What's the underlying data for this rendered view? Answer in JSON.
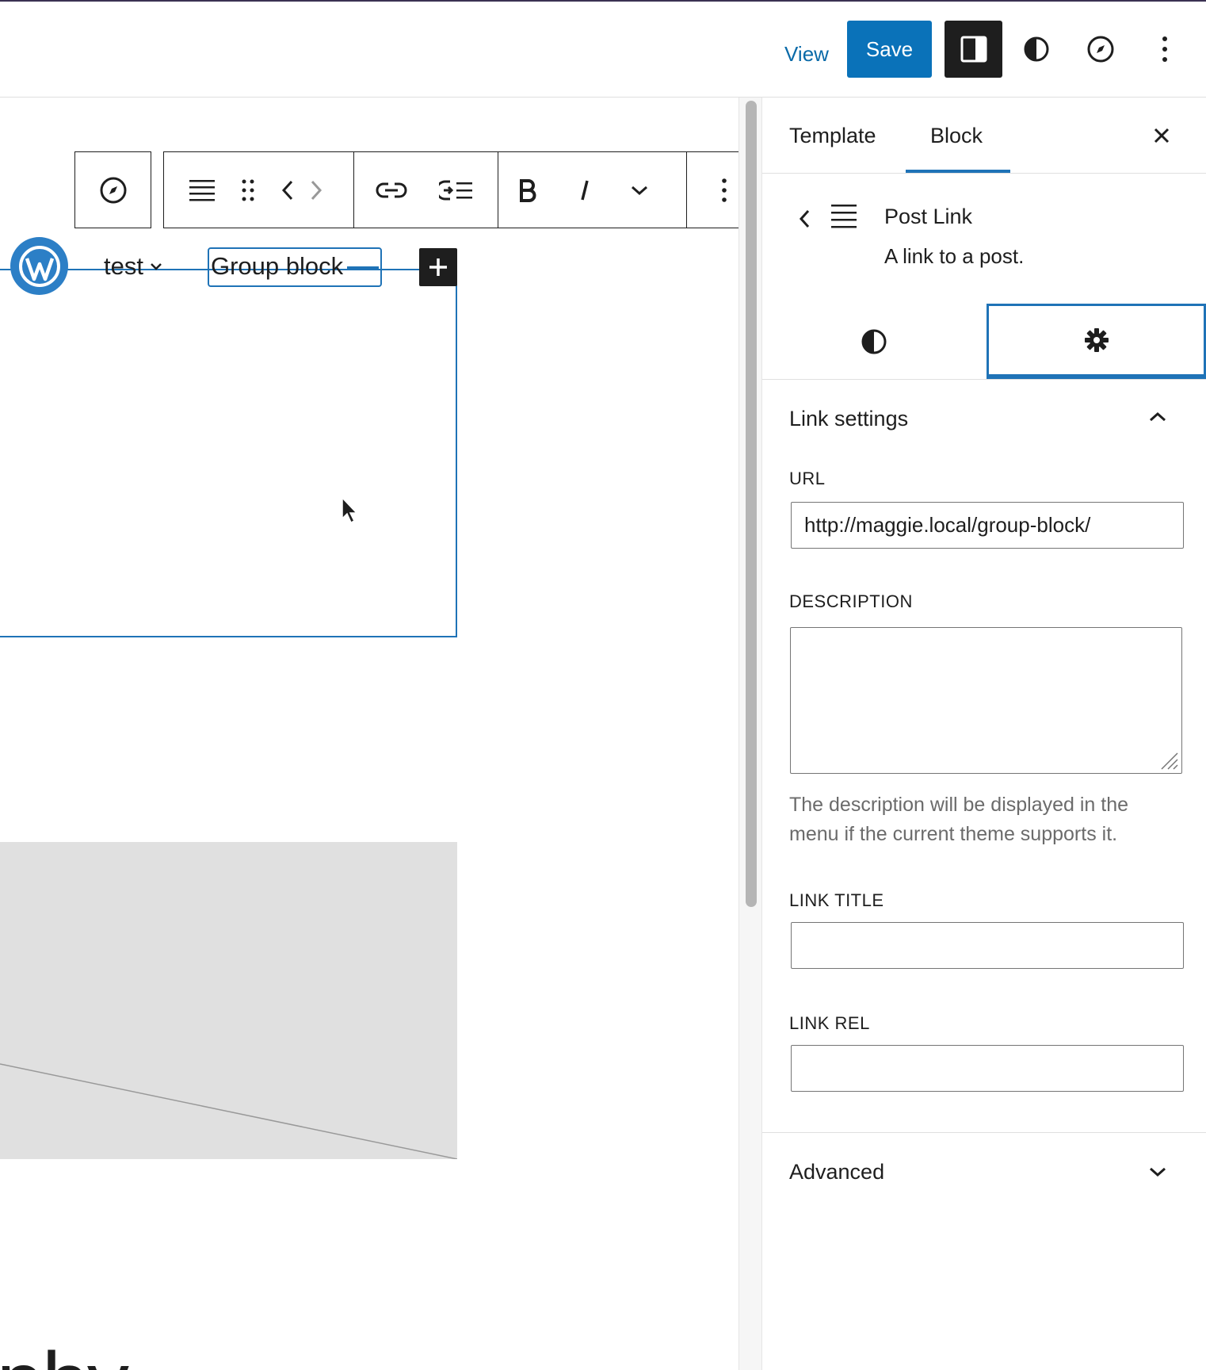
{
  "header": {
    "view_label": "View",
    "save_label": "Save"
  },
  "canvas": {
    "nav_items": [
      {
        "label": "test"
      },
      {
        "label": "Group block"
      }
    ],
    "big_text": "phy."
  },
  "sidebar": {
    "tabs": [
      {
        "label": "Template",
        "active": false
      },
      {
        "label": "Block",
        "active": true
      }
    ],
    "block_card": {
      "title": "Post Link",
      "description": "A link to a post."
    },
    "link_settings": {
      "title": "Link settings",
      "url_label": "URL",
      "url_value": "http://maggie.local/group-block/",
      "description_label": "DESCRIPTION",
      "description_value": "",
      "description_help": "The description will be displayed in the menu if the current theme supports it.",
      "link_title_label": "LINK TITLE",
      "link_title_value": "",
      "link_rel_label": "LINK REL",
      "link_rel_value": ""
    },
    "advanced": {
      "title": "Advanced"
    }
  },
  "colors": {
    "accent": "#1f73b7",
    "save_bg": "#0a72b9",
    "dark": "#1e1e1e"
  },
  "icons": [
    "settings-panel-icon",
    "contrast-icon",
    "compass-icon",
    "more-vertical-icon"
  ]
}
